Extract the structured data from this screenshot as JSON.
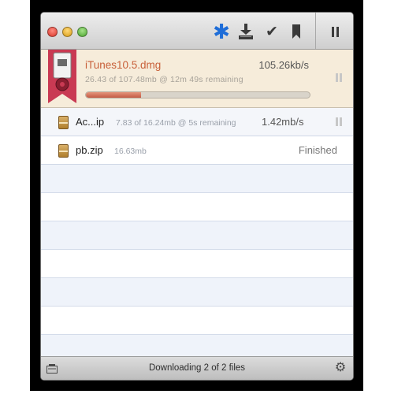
{
  "toolbar": {
    "icons": [
      "snowflake-star-icon",
      "download-tray-icon",
      "checkmark-icon",
      "bookmark-icon",
      "pause-icon"
    ],
    "accent": "#1e6dd8"
  },
  "downloads": [
    {
      "name": "iTunes10.5.dmg",
      "speed": "105.26kb/s",
      "detail": "26.43 of 107.48mb @ 12m 49s remaining",
      "progress_fraction": 0.246,
      "active": true
    },
    {
      "name": "Ac...ip",
      "detail": "7.83 of 16.24mb @ 5s remaining",
      "speed": "1.42mb/s"
    },
    {
      "name": "pb.zip",
      "detail": "16.63mb",
      "status": "Finished"
    }
  ],
  "statusbar": {
    "text": "Downloading 2 of 2 files"
  },
  "colors": {
    "active_name": "#c8603a",
    "active_row_bg": "#f6ecda",
    "ribbon": "#c93a53",
    "progress": "#c45c45"
  }
}
